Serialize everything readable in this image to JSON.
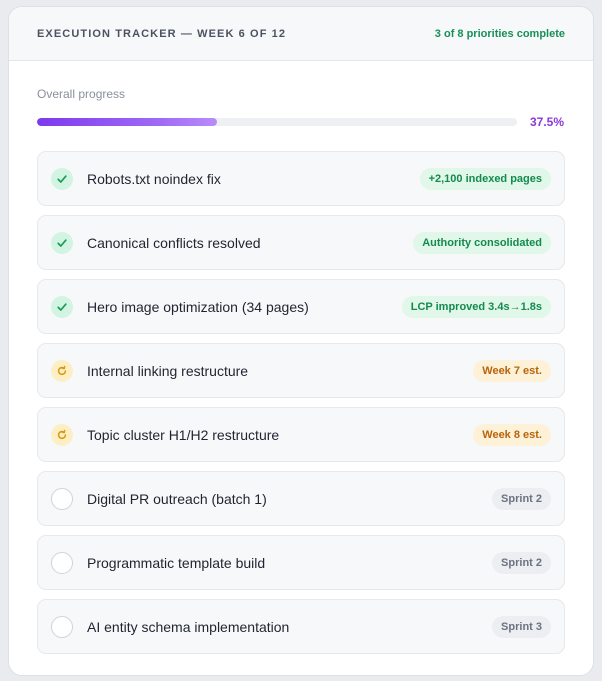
{
  "header": {
    "title": "EXECUTION TRACKER — WEEK 6 OF 12",
    "status": "3 of 8 priorities complete"
  },
  "progress": {
    "label": "Overall progress",
    "value_text": "37.5%",
    "percent": 37.5
  },
  "items": [
    {
      "label": "Robots.txt noindex fix",
      "status": "done",
      "icon": "check-icon",
      "badge": "+2,100 indexed pages"
    },
    {
      "label": "Canonical conflicts resolved",
      "status": "done",
      "icon": "check-icon",
      "badge": "Authority consolidated"
    },
    {
      "label": "Hero image optimization (34 pages)",
      "status": "done",
      "icon": "check-icon",
      "badge": "LCP improved 3.4s→1.8s"
    },
    {
      "label": "Internal linking restructure",
      "status": "progress",
      "icon": "refresh-icon",
      "badge": "Week 7 est."
    },
    {
      "label": "Topic cluster H1/H2 restructure",
      "status": "progress",
      "icon": "refresh-icon",
      "badge": "Week 8 est."
    },
    {
      "label": "Digital PR outreach (batch 1)",
      "status": "pending",
      "icon": "empty-circle-icon",
      "badge": "Sprint 2"
    },
    {
      "label": "Programmatic template build",
      "status": "pending",
      "icon": "empty-circle-icon",
      "badge": "Sprint 2"
    },
    {
      "label": "AI entity schema implementation",
      "status": "pending",
      "icon": "empty-circle-icon",
      "badge": "Sprint 3"
    }
  ],
  "colors": {
    "done": "#179058",
    "progress": "#d99a10",
    "pending": "#6b7280",
    "accent": "#8b38d8"
  }
}
